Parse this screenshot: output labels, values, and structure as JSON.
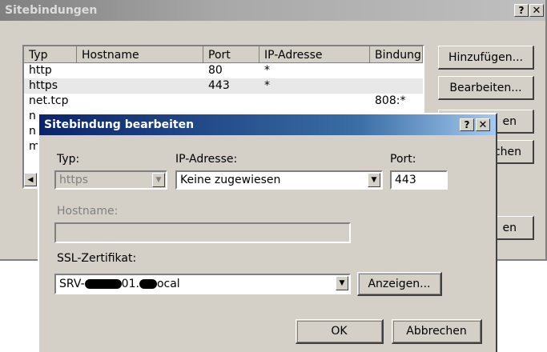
{
  "outer": {
    "title": "Sitebindungen",
    "help_btn": "?",
    "close_btn": "✕",
    "columns": [
      "Typ",
      "Hostname",
      "Port",
      "IP-Adresse",
      "Bindung"
    ],
    "rows": [
      {
        "typ": "http",
        "host": "",
        "port": "80",
        "ip": "*",
        "bind": ""
      },
      {
        "typ": "https",
        "host": "",
        "port": "443",
        "ip": "*",
        "bind": ""
      },
      {
        "typ": "net.tcp",
        "host": "",
        "port": "",
        "ip": "",
        "bind": "808:*"
      },
      {
        "typ": "n",
        "host": "",
        "port": "",
        "ip": "",
        "bind": ""
      },
      {
        "typ": "n",
        "host": "",
        "port": "",
        "ip": "",
        "bind": ""
      },
      {
        "typ": "m",
        "host": "",
        "port": "",
        "ip": "",
        "bind": ""
      }
    ],
    "scroll_left": "◀",
    "buttons": {
      "add": "Hinzufügen...",
      "edit": "Bearbeiten...",
      "remove": "Entfernen",
      "browse": "Durchsuchen",
      "close": "Schließen"
    },
    "buttons_visible": {
      "remove": "en",
      "browse": "chen",
      "close": "en"
    }
  },
  "dialog": {
    "title": "Sitebindung bearbeiten",
    "help_btn": "?",
    "close_btn": "✕",
    "type_label": "Typ:",
    "type_value": "https",
    "ip_label": "IP-Adresse:",
    "ip_value": "Keine zugewiesen",
    "port_label": "Port:",
    "port_value": "443",
    "hostname_label": "Hostname:",
    "hostname_value": "",
    "ssl_label": "SSL-Zertifikat:",
    "ssl_prefix": "SRV-",
    "ssl_mid": "01.",
    "ssl_suffix": "ocal",
    "view_btn": "Anzeigen...",
    "ok_btn": "OK",
    "cancel_btn": "Abbrechen"
  }
}
